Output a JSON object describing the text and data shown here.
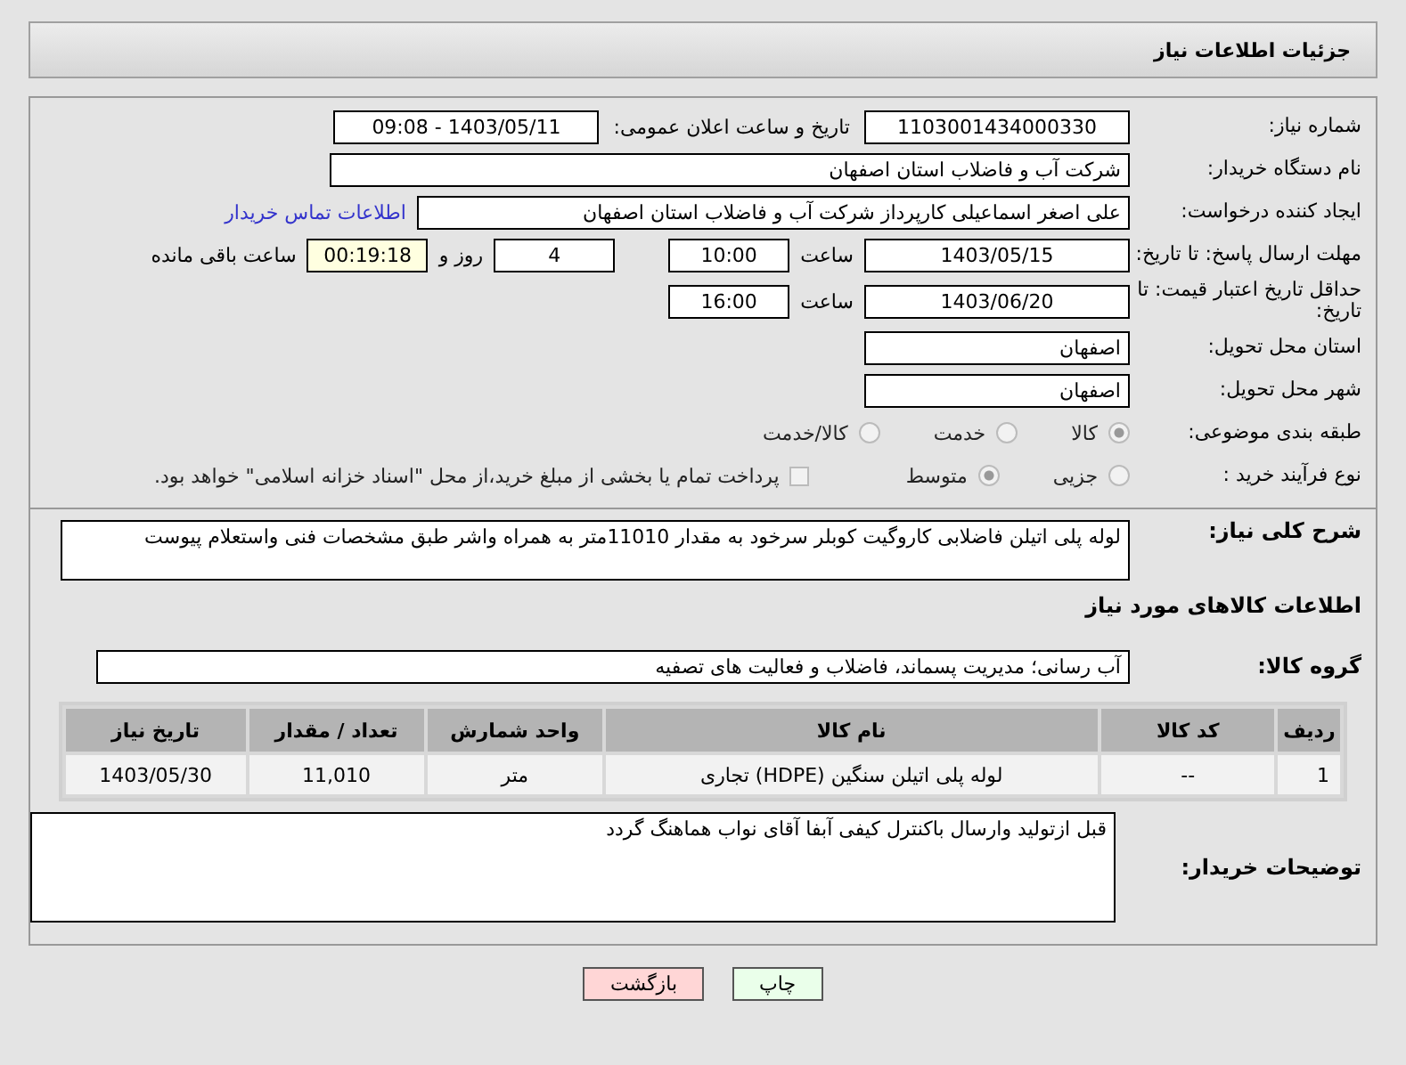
{
  "header": {
    "title": "جزئیات اطلاعات نیاز"
  },
  "need_number": {
    "label": "شماره نیاز:",
    "value": "1103001434000330"
  },
  "announce": {
    "label": "تاریخ و ساعت اعلان عمومی:",
    "value": "1403/05/11 - 09:08"
  },
  "buyer_org": {
    "label": "نام دستگاه خریدار:",
    "value": "شرکت آب و فاضلاب استان اصفهان"
  },
  "requester": {
    "label": "ایجاد کننده درخواست:",
    "value": "علی اصغر اسماعیلی کارپرداز شرکت آب و فاضلاب استان اصفهان",
    "link": "اطلاعات تماس خریدار"
  },
  "reply_deadline": {
    "label": "مهلت ارسال پاسخ: تا تاریخ:",
    "date": "1403/05/15",
    "time_label": "ساعت",
    "time": "10:00",
    "days": "4",
    "days_label": "روز و",
    "remaining": "00:19:18",
    "remaining_label": "ساعت باقی مانده"
  },
  "price_validity": {
    "label": "حداقل تاریخ اعتبار قیمت: تا تاریخ:",
    "date": "1403/06/20",
    "time_label": "ساعت",
    "time": "16:00"
  },
  "province": {
    "label": "استان محل تحویل:",
    "value": "اصفهان"
  },
  "city": {
    "label": "شهر محل تحویل:",
    "value": "اصفهان"
  },
  "category": {
    "label": "طبقه بندی موضوعی:",
    "options": [
      {
        "label": "کالا",
        "selected": true
      },
      {
        "label": "خدمت",
        "selected": false
      },
      {
        "label": "کالا/خدمت",
        "selected": false
      }
    ]
  },
  "process": {
    "label": "نوع فرآیند خرید :",
    "options": [
      {
        "label": "جزیی",
        "selected": false
      },
      {
        "label": "متوسط",
        "selected": true
      }
    ],
    "payment": {
      "checked": false,
      "label": "پرداخت تمام یا بخشی از مبلغ خرید،از محل \"اسناد خزانه اسلامی\" خواهد بود."
    }
  },
  "description": {
    "label": "شرح کلی نیاز:",
    "value": "لوله پلی اتیلن فاضلابی کاروگیت کوبلر سرخود به مقدار 11010متر به همراه واشر طبق مشخصات فنی واستعلام پیوست"
  },
  "goods": {
    "title": "اطلاعات کالاهای مورد نیاز",
    "group_label": "گروه کالا:",
    "group": "آب رسانی؛ مدیریت پسماند، فاضلاب و فعالیت های تصفیه",
    "columns": [
      "ردیف",
      "کد کالا",
      "نام کالا",
      "واحد شمارش",
      "تعداد / مقدار",
      "تاریخ نیاز"
    ],
    "rows": [
      [
        "1",
        "--",
        "لوله پلی اتیلن سنگین (HDPE) تجاری",
        "متر",
        "11,010",
        "1403/05/30"
      ]
    ]
  },
  "buyer_notes": {
    "label": "توضیحات خریدار:",
    "value": "قبل ازتولید وارسال باکنترل کیفی آبفا آقای نواب هماهنگ گردد"
  },
  "buttons": [
    {
      "label": "چاپ",
      "kind": "print"
    },
    {
      "label": "بازگشت",
      "kind": "back"
    }
  ]
}
